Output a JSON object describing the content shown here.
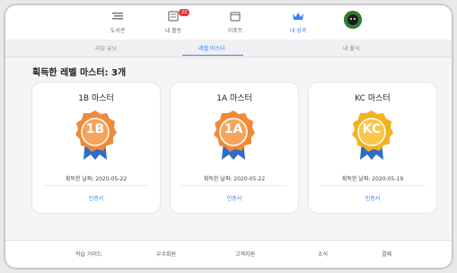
{
  "nav": {
    "items": [
      {
        "label": "도서관"
      },
      {
        "label": "내 활동",
        "badge": "22"
      },
      {
        "label": "리포트"
      },
      {
        "label": "내 성과"
      }
    ]
  },
  "subtabs": [
    {
      "label": "리딩 유닛"
    },
    {
      "label": "레벨 마스터"
    },
    {
      "label": "내 출석"
    }
  ],
  "headline": "획득한 레벨 마스터: 3개",
  "cards": [
    {
      "title": "1B 마스터",
      "medal_text": "1B",
      "date": "획득한 날짜: 2020-05-22",
      "cert": "인증서",
      "color": "#f08a3b"
    },
    {
      "title": "1A 마스터",
      "medal_text": "1A",
      "date": "획득한 날짜: 2020-05-22",
      "cert": "인증서",
      "color": "#f08a3b"
    },
    {
      "title": "KC 마스터",
      "medal_text": "KC",
      "date": "획득한 날짜: 2020-05-19",
      "cert": "인증서",
      "color": "#f2b21e"
    }
  ],
  "footer": {
    "items": [
      {
        "label": "학습 가이드"
      },
      {
        "label": "우수회원"
      },
      {
        "label": "고객지원"
      },
      {
        "label": "소식"
      },
      {
        "label": "결제"
      }
    ]
  }
}
